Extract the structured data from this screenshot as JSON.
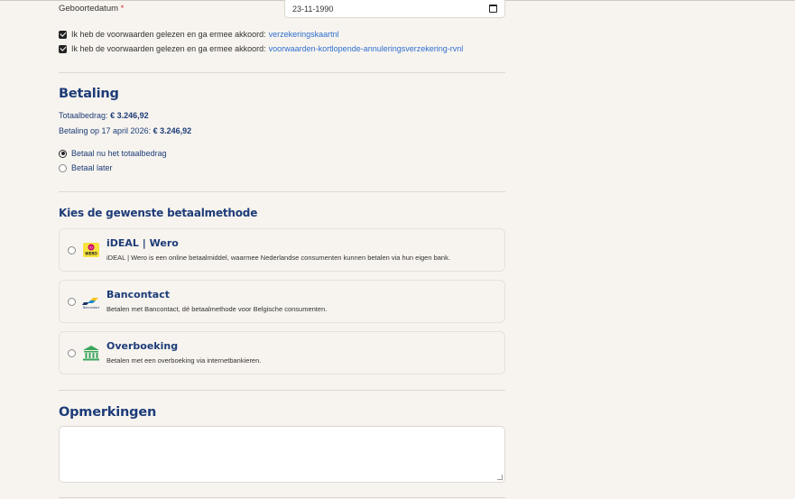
{
  "birth": {
    "label": "Geboortedatum",
    "required_mark": "*",
    "value": "23-11-1990"
  },
  "agreements": [
    {
      "text": "Ik heb de voorwaarden gelezen en ga ermee akkoord:",
      "link": "verzekeringskaartnl",
      "checked": true
    },
    {
      "text": "Ik heb de voorwaarden gelezen en ga ermee akkoord:",
      "link": "voorwaarden-kortlopende-annuleringsverzekering-rvnl",
      "checked": true
    }
  ],
  "betaling": {
    "heading": "Betaling",
    "total_label": "Totaalbedrag:",
    "total_value": "€ 3.246,92",
    "date_label": "Betaling op 17 april 2026:",
    "date_value": "€ 3.246,92",
    "options": [
      {
        "label": "Betaal nu het totaalbedrag",
        "selected": true
      },
      {
        "label": "Betaal later",
        "selected": false
      }
    ]
  },
  "methods": {
    "heading": "Kies de gewenste betaalmethode",
    "items": [
      {
        "title": "iDEAL | Wero",
        "desc": "iDEAL | Wero is een online betaalmiddel, waarmee Nederlandse consumenten kunnen betalen via hun eigen bank.",
        "icon": "ideal-wero-logo"
      },
      {
        "title": "Bancontact",
        "desc": "Betalen met Bancontact, dé betaalmethode voor Belgische consumenten.",
        "icon": "bancontact-logo"
      },
      {
        "title": "Overboeking",
        "desc": "Betalen met een overboeking via internetbankieren.",
        "icon": "bank-icon"
      }
    ]
  },
  "remarks": {
    "heading": "Opmerkingen",
    "value": ""
  },
  "colors": {
    "accent": "#1d3c78",
    "link": "#2f6fd1",
    "background": "#f7f4ef"
  }
}
